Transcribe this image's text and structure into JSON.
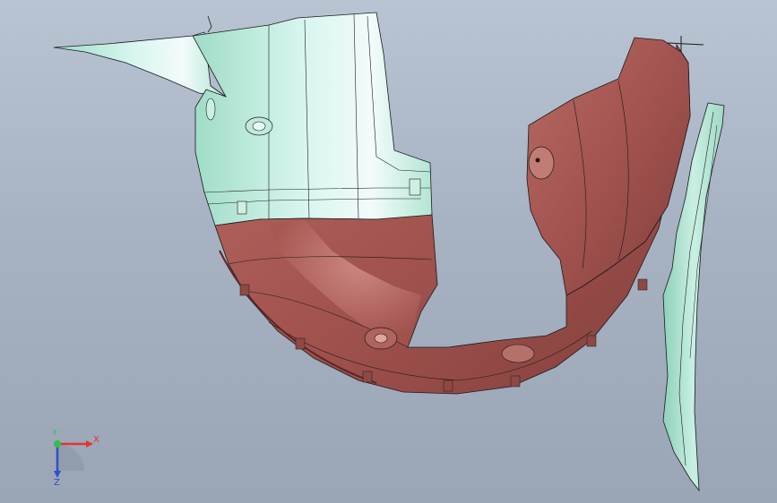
{
  "viewport": {
    "colors": {
      "background_top": "#b9c4d3",
      "background_bottom": "#9aa5b6",
      "part_green": "#a9e3cf",
      "part_green_light": "#d2f3ea",
      "part_red": "#a85a55",
      "part_red_dark": "#7e3c39",
      "edge_line": "#1a1a1a"
    },
    "parts": [
      {
        "name": "upper-liner-panel",
        "color": "green"
      },
      {
        "name": "wheel-arch-liner",
        "color": "red"
      },
      {
        "name": "front-liner-section",
        "color": "red"
      },
      {
        "name": "side-trim-strip",
        "color": "green"
      }
    ]
  },
  "triad": {
    "x_label": "X",
    "y_label": "Y",
    "z_label": "Z",
    "x_color": "#e8332a",
    "y_color": "#2fc14a",
    "z_color": "#2f4fc8"
  }
}
